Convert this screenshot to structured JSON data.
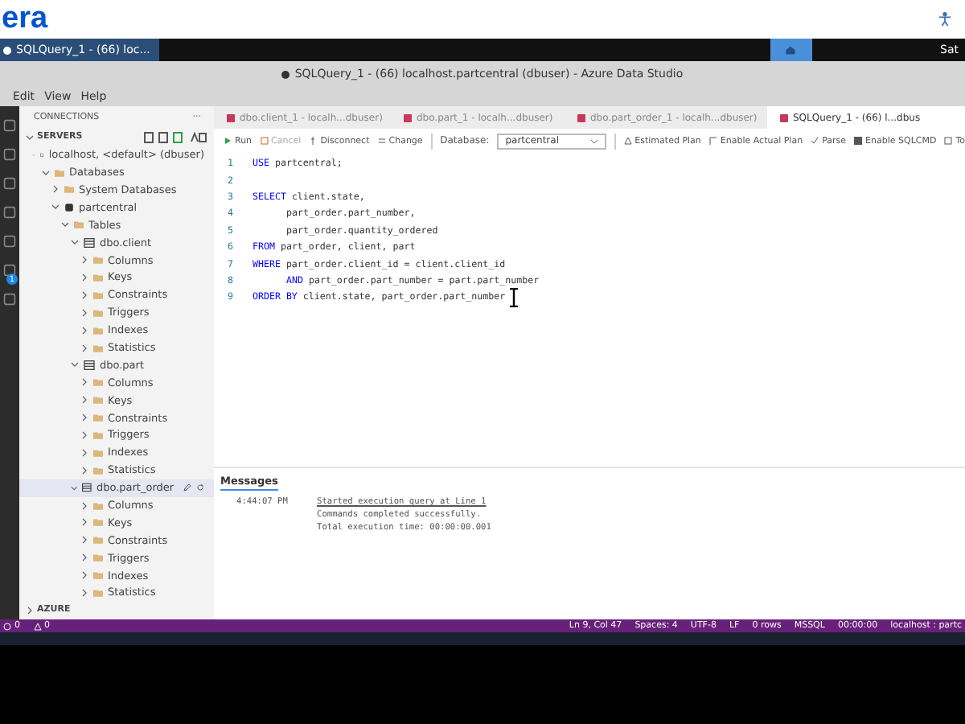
{
  "site_header": {
    "logo": "era"
  },
  "taskbar": {
    "task": "SQLQuery_1 - (66) loc...",
    "clock": "Sat"
  },
  "window": {
    "title": "SQLQuery_1 - (66) localhost.partcentral (dbuser) - Azure Data Studio",
    "unsaved": true
  },
  "menu": [
    "Edit",
    "View",
    "Help"
  ],
  "activity_bar": {
    "badge": "1"
  },
  "sidebar": {
    "title": "CONNECTIONS",
    "more": "···",
    "section": "SERVERS",
    "footer": "AZURE",
    "tree": [
      {
        "label": "localhost, <default> (dbuser)",
        "kind": "server",
        "expanded": true,
        "selected": false,
        "children": [
          {
            "label": "Databases",
            "kind": "folder",
            "expanded": true,
            "selected": false,
            "children": [
              {
                "label": "System Databases",
                "kind": "folder",
                "expanded": false,
                "selected": false
              },
              {
                "label": "partcentral",
                "kind": "database",
                "expanded": true,
                "selected": false,
                "children": [
                  {
                    "label": "Tables",
                    "kind": "folder",
                    "expanded": true,
                    "selected": false,
                    "children": [
                      {
                        "label": "dbo.client",
                        "kind": "table",
                        "expanded": true,
                        "selected": false,
                        "children": [
                          {
                            "label": "Columns",
                            "kind": "folder",
                            "expanded": false,
                            "selected": false
                          },
                          {
                            "label": "Keys",
                            "kind": "folder",
                            "expanded": false,
                            "selected": false
                          },
                          {
                            "label": "Constraints",
                            "kind": "folder",
                            "expanded": false,
                            "selected": false
                          },
                          {
                            "label": "Triggers",
                            "kind": "folder",
                            "expanded": false,
                            "selected": false
                          },
                          {
                            "label": "Indexes",
                            "kind": "folder",
                            "expanded": false,
                            "selected": false
                          },
                          {
                            "label": "Statistics",
                            "kind": "folder",
                            "expanded": false,
                            "selected": false
                          }
                        ]
                      },
                      {
                        "label": "dbo.part",
                        "kind": "table",
                        "expanded": true,
                        "selected": false,
                        "children": [
                          {
                            "label": "Columns",
                            "kind": "folder",
                            "expanded": false,
                            "selected": false
                          },
                          {
                            "label": "Keys",
                            "kind": "folder",
                            "expanded": false,
                            "selected": false
                          },
                          {
                            "label": "Constraints",
                            "kind": "folder",
                            "expanded": false,
                            "selected": false
                          },
                          {
                            "label": "Triggers",
                            "kind": "folder",
                            "expanded": false,
                            "selected": false
                          },
                          {
                            "label": "Indexes",
                            "kind": "folder",
                            "expanded": false,
                            "selected": false
                          },
                          {
                            "label": "Statistics",
                            "kind": "folder",
                            "expanded": false,
                            "selected": false
                          }
                        ]
                      },
                      {
                        "label": "dbo.part_order",
                        "kind": "table",
                        "expanded": true,
                        "selected": true,
                        "children": [
                          {
                            "label": "Columns",
                            "kind": "folder",
                            "expanded": false,
                            "selected": false
                          },
                          {
                            "label": "Keys",
                            "kind": "folder",
                            "expanded": false,
                            "selected": false
                          },
                          {
                            "label": "Constraints",
                            "kind": "folder",
                            "expanded": false,
                            "selected": false
                          },
                          {
                            "label": "Triggers",
                            "kind": "folder",
                            "expanded": false,
                            "selected": false
                          },
                          {
                            "label": "Indexes",
                            "kind": "folder",
                            "expanded": false,
                            "selected": false
                          },
                          {
                            "label": "Statistics",
                            "kind": "folder",
                            "expanded": false,
                            "selected": false
                          }
                        ]
                      }
                    ]
                  }
                ]
              }
            ]
          }
        ]
      }
    ]
  },
  "tabs": [
    {
      "label": "dbo.client_1 - localh...dbuser)",
      "selected": false
    },
    {
      "label": "dbo.part_1 - localh...dbuser)",
      "selected": false
    },
    {
      "label": "dbo.part_order_1 - localh...dbuser)",
      "selected": false
    },
    {
      "label": "SQLQuery_1 - (66) l...dbus",
      "selected": true
    }
  ],
  "toolbar": {
    "run": "Run",
    "cancel": "Cancel",
    "disconnect": "Disconnect",
    "change": "Change",
    "database_label": "Database:",
    "database": "partcentral",
    "estimated_plan": "Estimated Plan",
    "actual_plan": "Enable Actual Plan",
    "parse": "Parse",
    "sqlcmd": "Enable SQLCMD",
    "more": "To"
  },
  "editor": {
    "lines": [
      {
        "number": "1",
        "segments": [
          {
            "kind": "keyword",
            "text": "USE"
          },
          {
            "kind": "plain",
            "text": " partcentral;"
          }
        ]
      },
      {
        "number": "2"
      },
      {
        "number": "3",
        "segments": [
          {
            "kind": "keyword",
            "text": "SELECT"
          },
          {
            "kind": "plain",
            "text": " client.state,"
          }
        ]
      },
      {
        "number": "4",
        "indent": true,
        "segments": [
          {
            "kind": "plain",
            "text": "part_order.part_number,"
          }
        ]
      },
      {
        "number": "5",
        "indent": true,
        "segments": [
          {
            "kind": "plain",
            "text": "part_order.quantity_ordered"
          }
        ]
      },
      {
        "number": "6",
        "segments": [
          {
            "kind": "keyword",
            "text": "FROM"
          },
          {
            "kind": "plain",
            "text": " part_order, client, part"
          }
        ]
      },
      {
        "number": "7",
        "segments": [
          {
            "kind": "keyword",
            "text": "WHERE"
          },
          {
            "kind": "plain",
            "text": " part_order.client_id = client.client_id"
          }
        ]
      },
      {
        "number": "8",
        "indent": true,
        "segments": [
          {
            "kind": "keyword",
            "text": "AND"
          },
          {
            "kind": "plain",
            "text": " part_order.part_number = part.part_number"
          }
        ]
      },
      {
        "number": "9",
        "segments": [
          {
            "kind": "keyword",
            "text": "ORDER BY"
          },
          {
            "kind": "plain",
            "text": " client.state, part_order.part_number"
          }
        ]
      }
    ]
  },
  "messages": {
    "title": "Messages",
    "entries": [
      {
        "time": "4:44:07 PM",
        "lines": [
          {
            "text": "Started execution query at Line 1",
            "kind": "link"
          },
          {
            "text": "Commands completed successfully.",
            "kind": "plain"
          },
          {
            "text": "Total execution time: 00:00:00.001",
            "kind": "plain"
          }
        ]
      }
    ]
  },
  "status_bar": {
    "errors": "0",
    "warnings": "0",
    "items": [
      "Ln 9, Col 47",
      "Spaces: 4",
      "UTF-8",
      "LF",
      "0 rows",
      "MSSQL",
      "00:00:00",
      "localhost : partc"
    ]
  }
}
